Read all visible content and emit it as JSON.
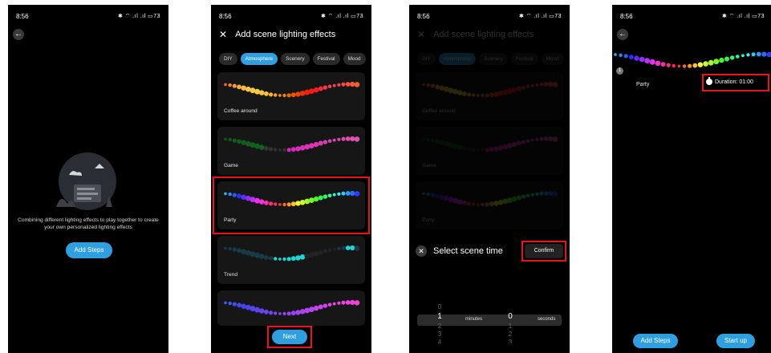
{
  "status": {
    "time": "8:56",
    "icons": "✱ ⌔ .ıl .ıl ▭",
    "battery": "73"
  },
  "panel1": {
    "empty_text": "Combining different lighting effects to play together to create your own personalized lighting effects",
    "add_steps": "Add Steps"
  },
  "panel2": {
    "title": "Add scene lighting effects",
    "tabs": [
      "DIY",
      "Atmosphere",
      "Scenery",
      "Festival",
      "Mood"
    ],
    "active_tab": "Atmosphere",
    "cards": [
      "Coffee around",
      "Game",
      "Party",
      "Trend"
    ],
    "next": "Next"
  },
  "panel3": {
    "title": "Add scene lighting effects",
    "tabs": [
      "DIY",
      "Atmosphere",
      "Scenery",
      "Festival",
      "Mood"
    ],
    "cards": [
      "Coffee around",
      "Game",
      "Party"
    ],
    "sheet_title": "Select scene time",
    "confirm": "Confirm",
    "minutes_values": [
      "0",
      "1",
      "2",
      "3",
      "4"
    ],
    "seconds_values": [
      "0",
      "1",
      "2",
      "3"
    ],
    "minutes_label": "minutes",
    "seconds_label": "seconds"
  },
  "panel4": {
    "step_number": "1",
    "effect_name": "Party",
    "duration": "Duration: 01:00",
    "add_steps": "Add Steps",
    "start_up": "Start up"
  },
  "colors": {
    "accent": "#2f9fe0",
    "highlight": "#e8131c",
    "background": "#000000"
  }
}
